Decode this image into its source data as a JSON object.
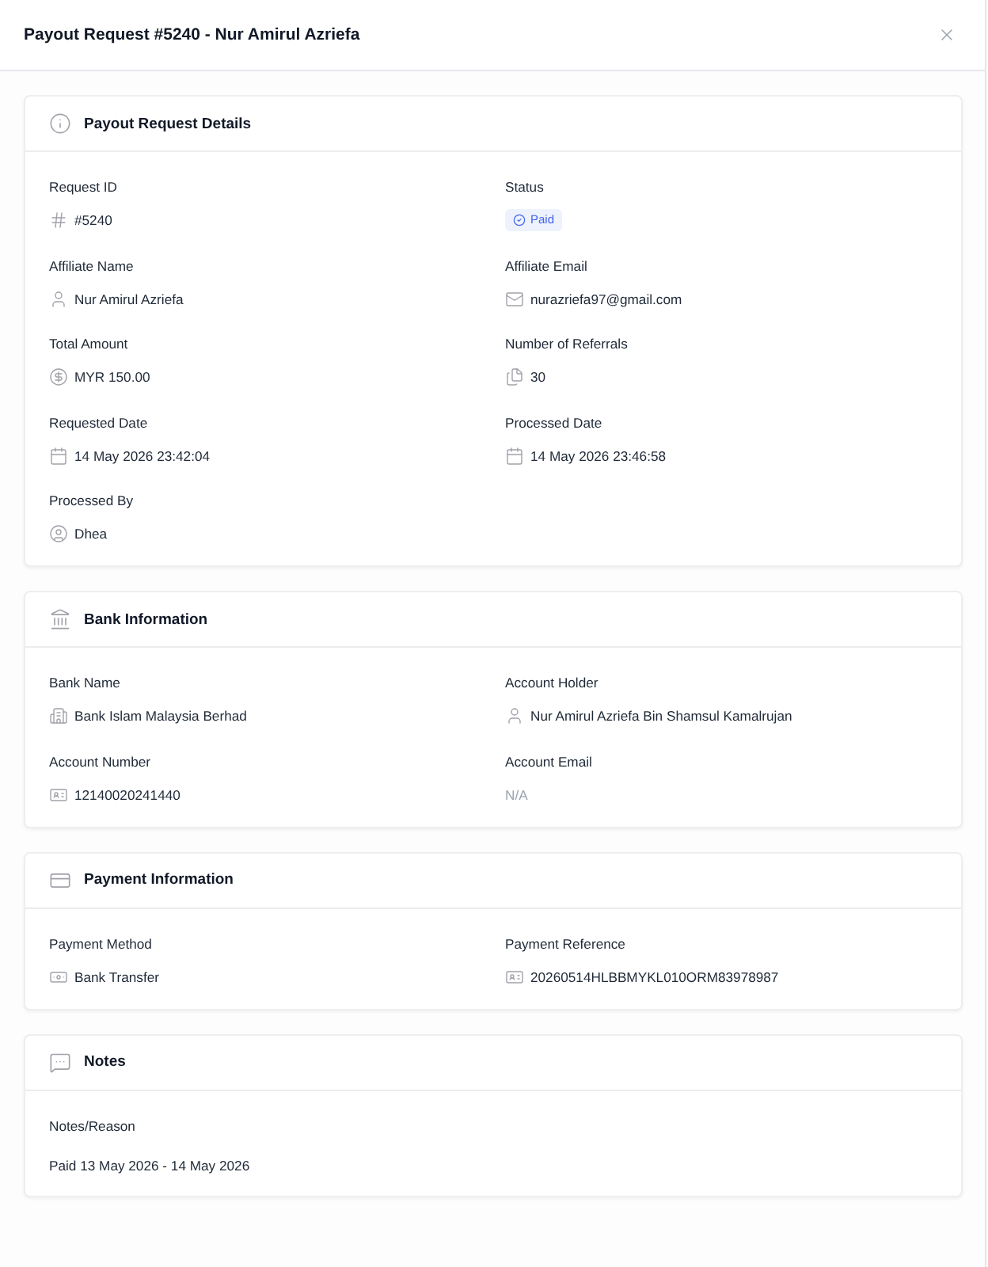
{
  "dialog": {
    "title": "Payout Request #5240 - Nur Amirul Azriefa"
  },
  "sections": [
    {
      "title": "Payout Request Details",
      "fields": [
        {
          "label": "Request ID",
          "value": "#5240",
          "kind": "text"
        },
        {
          "label": "Status",
          "value": "Paid",
          "kind": "status"
        },
        {
          "label": "Affiliate Name",
          "value": "Nur Amirul Azriefa",
          "kind": "text"
        },
        {
          "label": "Affiliate Email",
          "value": "nurazriefa97@gmail.com",
          "kind": "text"
        },
        {
          "label": "Total Amount",
          "value": "MYR 150.00",
          "kind": "text"
        },
        {
          "label": "Number of Referrals",
          "value": "30",
          "kind": "text"
        },
        {
          "label": "Requested Date",
          "value": "14 May 2026 23:42:04",
          "kind": "text"
        },
        {
          "label": "Processed Date",
          "value": "14 May 2026 23:46:58",
          "kind": "text"
        },
        {
          "label": "Processed By",
          "value": "Dhea",
          "kind": "text"
        }
      ]
    },
    {
      "title": "Bank Information",
      "fields": [
        {
          "label": "Bank Name",
          "value": "Bank Islam Malaysia Berhad",
          "kind": "text"
        },
        {
          "label": "Account Holder",
          "value": "Nur Amirul Azriefa Bin Shamsul Kamalrujan",
          "kind": "text"
        },
        {
          "label": "Account Number",
          "value": "12140020241440",
          "kind": "text"
        },
        {
          "label": "Account Email",
          "value": "N/A",
          "kind": "missing"
        }
      ]
    },
    {
      "title": "Payment Information",
      "fields": [
        {
          "label": "Payment Method",
          "value": "Bank Transfer",
          "kind": "text"
        },
        {
          "label": "Payment Reference",
          "value": "20260514HLBBMYKL010ORM83978987",
          "kind": "text"
        }
      ]
    },
    {
      "title": "Notes",
      "fields": [
        {
          "label": "Notes/Reason",
          "value": "Paid 13 May 2026 - 14 May 2026",
          "kind": "note"
        }
      ]
    }
  ]
}
